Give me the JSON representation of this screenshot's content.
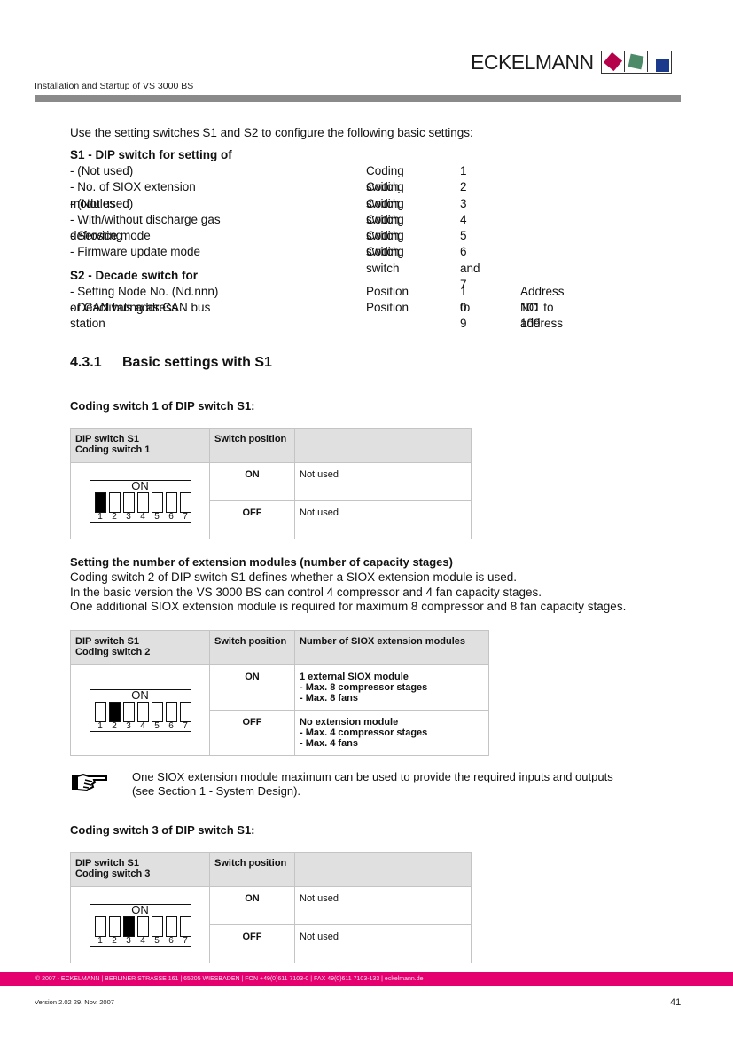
{
  "header": {
    "brand": "ECKELMANN",
    "logo_colors": [
      "#b5004a",
      "#4c8a68",
      "#1b3a8c"
    ],
    "doc_title": "Installation and Startup of VS 3000 BS",
    "bar_color": "#8a8a8a"
  },
  "intro": "Use the setting switches S1 and S2 to configure the following basic settings:",
  "s1": {
    "heading": "S1 - DIP switch for setting of",
    "rows": [
      {
        "label": "- (Not used)",
        "kind": "Coding switch",
        "value": "1"
      },
      {
        "label": "- No. of SIOX extension modules",
        "kind": "Coding switch",
        "value": "2"
      },
      {
        "label": "- (Not used)",
        "kind": "Coding switch",
        "value": "3"
      },
      {
        "label": "- With/without discharge gas defrosting",
        "kind": "Coding switch",
        "value": "4"
      },
      {
        "label": "- Service mode",
        "kind": "Coding switch",
        "value": "5"
      },
      {
        "label": "- Firmware update mode",
        "kind": "Coding switch",
        "value": "6 and 7"
      }
    ]
  },
  "s2": {
    "heading": "S2 - Decade switch for",
    "rows": [
      {
        "label": "- Setting Node No. (Nd.nnn) or CAN bus address",
        "kind": "Position",
        "value": "1 to 9",
        "extra": "Address 101 to 109"
      },
      {
        "label": "- Deactivating as CAN bus station",
        "kind": "Position",
        "value": "0",
        "extra": "NO address"
      }
    ]
  },
  "section": {
    "number": "4.3.1",
    "title": "Basic settings with S1"
  },
  "block1": {
    "subheading": "Coding switch 1 of DIP switch S1:",
    "table": {
      "header": [
        "DIP switch S1",
        "Coding switch 1",
        "Switch position",
        ""
      ],
      "dip_on_label": "ON",
      "active_switch": 1,
      "rows": [
        {
          "position": "ON",
          "text": [
            "Not used"
          ]
        },
        {
          "position": "OFF",
          "text": [
            "Not used"
          ]
        }
      ]
    }
  },
  "block2": {
    "subheading": "Setting the number of extension modules (number of capacity stages)",
    "paragraph": [
      "Coding switch 2 of DIP switch S1 defines whether a SIOX extension module is used.",
      "In the basic version the VS 3000 BS can control 4 compressor and 4 fan capacity stages.",
      "One additional SIOX extension module is required for maximum 8 compressor and 8 fan capacity stages."
    ],
    "table": {
      "header": [
        "DIP switch S1",
        "Coding switch 2",
        "Switch position",
        "Number of SIOX extension modules"
      ],
      "dip_on_label": "ON",
      "active_switch": 2,
      "rows": [
        {
          "position": "ON",
          "text": [
            "1 external SIOX module",
            "- Max. 8 compressor stages",
            "- Max. 8 fans"
          ]
        },
        {
          "position": "OFF",
          "text": [
            "No extension module",
            "- Max. 4 compressor stages",
            "- Max. 4 fans"
          ]
        }
      ]
    }
  },
  "note": {
    "icon": "pointing-hand-icon",
    "lines": [
      "One SIOX extension module maximum can be used to provide the required inputs and outputs",
      "(see Section 1 - System Design)."
    ]
  },
  "block3": {
    "subheading": "Coding switch 3 of DIP switch S1:",
    "table": {
      "header": [
        "DIP switch S1",
        "Coding switch 3",
        "Switch position",
        ""
      ],
      "dip_on_label": "ON",
      "active_switch": 3,
      "rows": [
        {
          "position": "ON",
          "text": [
            "Not used"
          ]
        },
        {
          "position": "OFF",
          "text": [
            "Not used"
          ]
        }
      ]
    }
  },
  "dip_numbers": [
    "1",
    "2",
    "3",
    "4",
    "5",
    "6",
    "7"
  ],
  "footer": {
    "bar_color": "#e4006f",
    "contact": "© 2007 - ECKELMANN | BERLINER STRASSE 161 | 65205 WIESBADEN | FON +49(0)611 7103-0 | FAX 49(0)611 7103-133 | eckelmann.de",
    "version": "Version 2.02   29. Nov. 2007",
    "page_number": "41"
  }
}
